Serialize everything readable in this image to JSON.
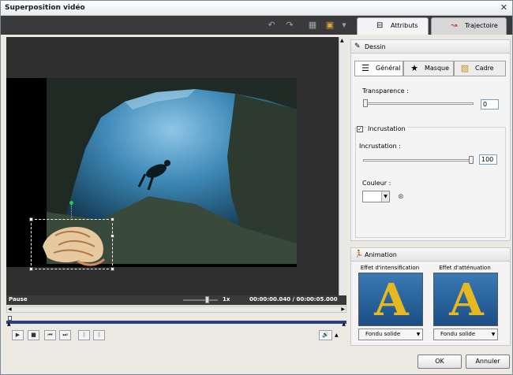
{
  "window": {
    "title": "Superposition vidéo"
  },
  "tabs": [
    {
      "label": "Attributs"
    },
    {
      "label": "Trajectoire"
    }
  ],
  "player": {
    "status": "Pause",
    "speed": "1x",
    "time": "00:00:00.040 / 00:00:05.000"
  },
  "dessin": {
    "header": "Dessin",
    "subtabs": [
      {
        "label": "Général"
      },
      {
        "label": "Masque"
      },
      {
        "label": "Cadre"
      }
    ],
    "transparence": {
      "label": "Transparence :",
      "value": "0",
      "fraction": 0.0
    },
    "incrustation_group": {
      "label": "Incrustation",
      "checked": true
    },
    "incrustation": {
      "label": "Incrustation :",
      "value": "100",
      "fraction": 1.0
    },
    "couleur": {
      "label": "Couleur :"
    }
  },
  "animation": {
    "header": "Animation",
    "intensification": {
      "title": "Effet d'intensification",
      "option": "Fondu solide"
    },
    "attenuation": {
      "title": "Effet d'atténuation",
      "option": "Fondu solide"
    }
  },
  "buttons": {
    "ok": "OK",
    "cancel": "Annuler"
  },
  "icons": {
    "check": "✓",
    "effect_letter": "A"
  }
}
